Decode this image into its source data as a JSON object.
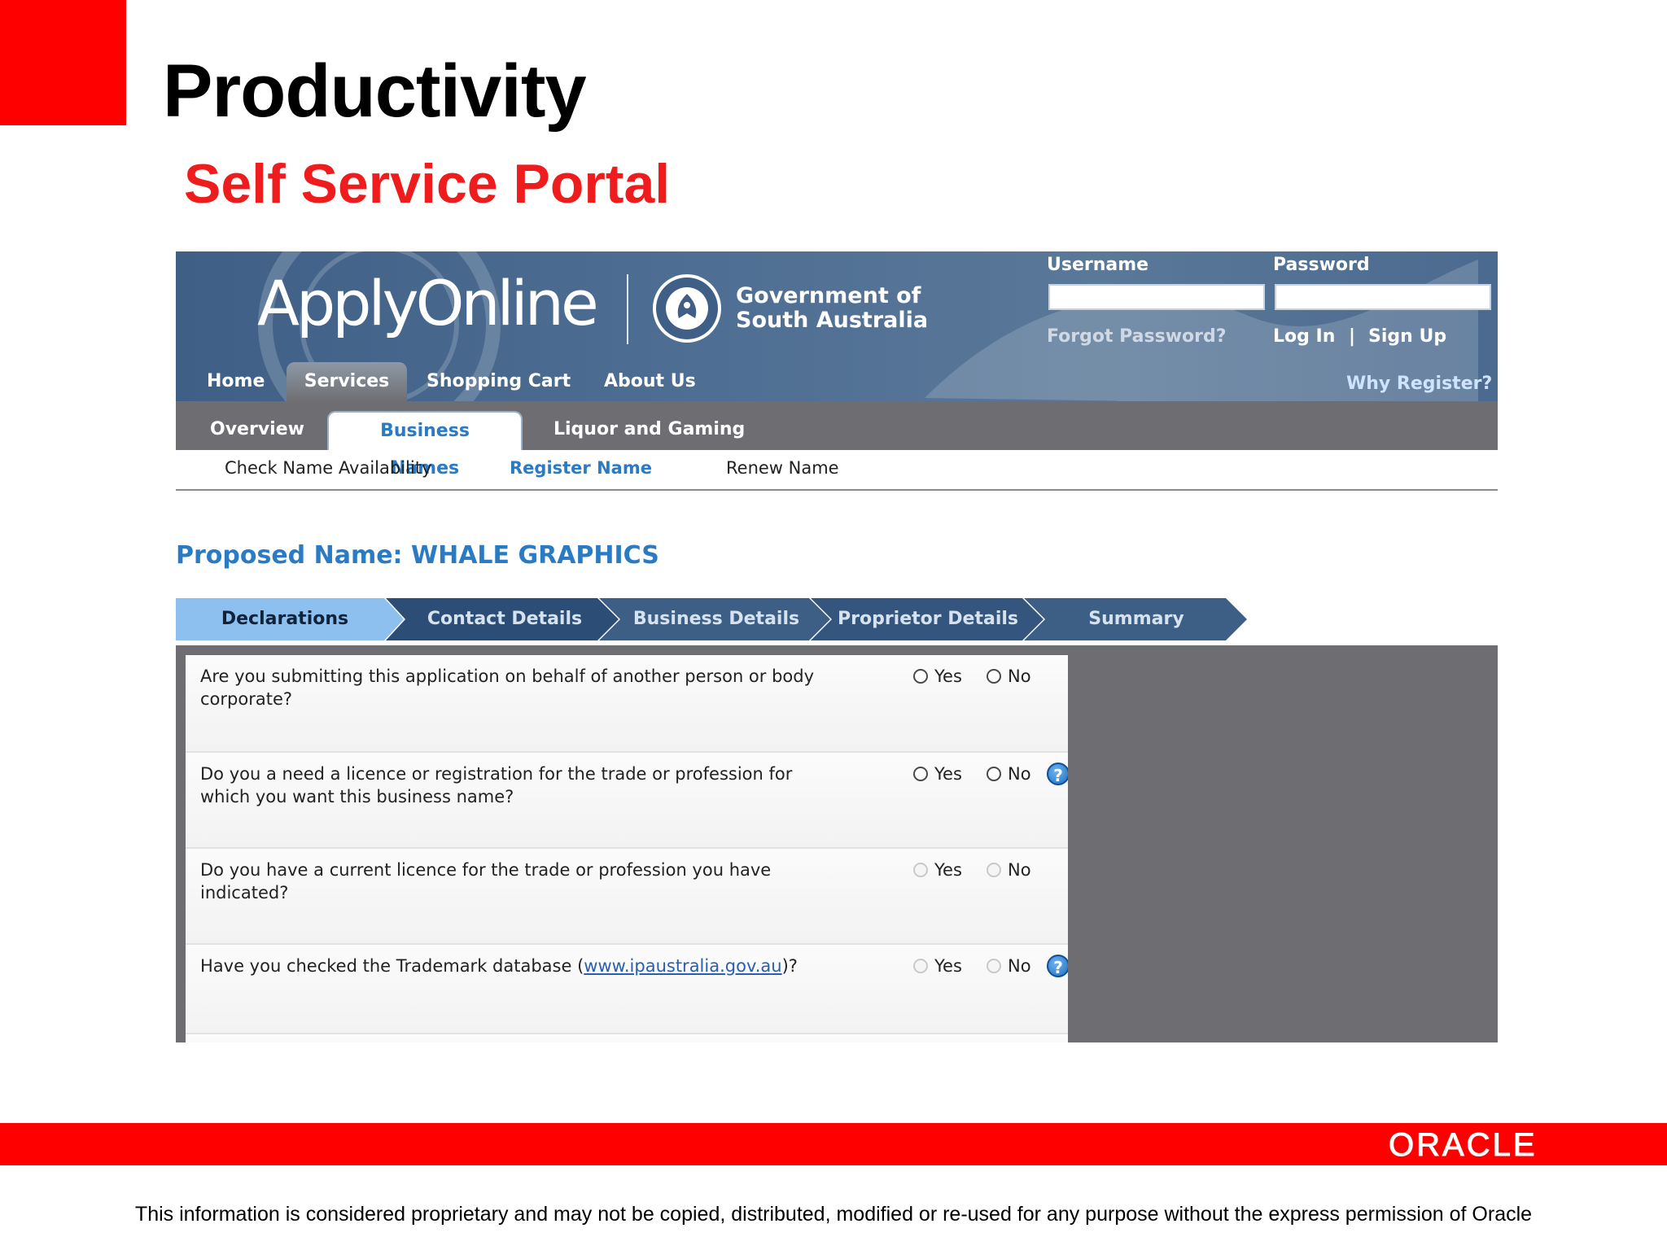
{
  "slide": {
    "title": "Productivity",
    "subtitle": "Self Service Portal",
    "disclaimer": "This information is considered proprietary and may not be copied, distributed, modified or re-used for any purpose without the express permission of Oracle",
    "footer_logo": "ORACLE",
    "colors": {
      "brand_red": "#ff0000",
      "subtitle_red": "#ee1c1c"
    }
  },
  "portal": {
    "logo": "ApplyOnline",
    "gov_line1": "Government of",
    "gov_line2": "South Australia",
    "seal_icon": "government-seal-icon",
    "login": {
      "username_label": "Username",
      "username_value": "",
      "password_label": "Password",
      "password_value": "",
      "forgot_password": "Forgot Password?",
      "log_in": "Log In",
      "separator": "|",
      "sign_up": "Sign Up",
      "why_register": "Why Register?"
    },
    "main_nav": [
      {
        "label": "Home",
        "active": false
      },
      {
        "label": "Services",
        "active": true
      },
      {
        "label": "Shopping Cart",
        "active": false
      },
      {
        "label": "About Us",
        "active": false
      }
    ],
    "sub_nav": [
      {
        "label": "Overview",
        "active": false
      },
      {
        "label": "Business Names",
        "active": true
      },
      {
        "label": "Liquor and Gaming",
        "active": false
      }
    ],
    "tertiary_nav": [
      {
        "label": "Check Name Availability",
        "active": false
      },
      {
        "label": "Register Name",
        "active": true
      },
      {
        "label": "Renew Name",
        "active": false
      }
    ],
    "proposed_name": "Proposed Name: WHALE GRAPHICS",
    "steps": [
      {
        "label": "Declarations",
        "active": true
      },
      {
        "label": "Contact Details",
        "active": false
      },
      {
        "label": "Business Details",
        "active": false
      },
      {
        "label": "Proprietor Details",
        "active": false
      },
      {
        "label": "Summary",
        "active": false
      }
    ],
    "questions": [
      {
        "line1": "Are you submitting this application on behalf of another person or body",
        "line2": "corporate?",
        "yes": "Yes",
        "no": "No",
        "enabled": true,
        "help": false
      },
      {
        "line1": "Do you a need a licence or registration for the trade or profession for",
        "line2": "which you want this business name?",
        "yes": "Yes",
        "no": "No",
        "enabled": true,
        "help": true
      },
      {
        "line1": "Do you have a current licence for the trade or profession you have",
        "line2": "indicated?",
        "yes": "Yes",
        "no": "No",
        "enabled": false,
        "help": false
      },
      {
        "prefix": "Have you checked the Trademark database (",
        "link": "www.ipaustralia.gov.au",
        "suffix": ")?",
        "yes": "Yes",
        "no": "No",
        "enabled": false,
        "help": true
      }
    ],
    "help_glyph": "?",
    "colors": {
      "banner": "#4e6e93",
      "link_blue": "#2a7bc4",
      "step_active": "#8ec0ef",
      "step_inactive": "#3d5f86",
      "form_bg": "#6e6e72"
    }
  }
}
